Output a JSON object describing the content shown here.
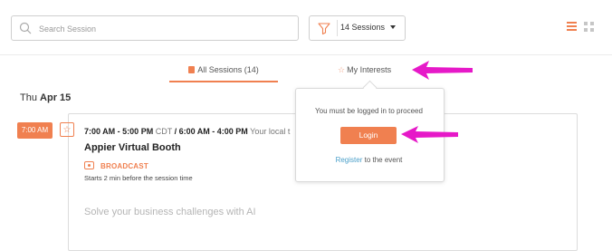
{
  "search": {
    "placeholder": "Search Session",
    "icon": "search-icon"
  },
  "filter": {
    "label": "14 Sessions",
    "icon": "funnel-icon"
  },
  "view_toggle": {
    "list_icon": "list-view-icon",
    "grid_icon": "grid-view-icon"
  },
  "tabs": [
    {
      "label": "All Sessions (14)",
      "icon": "book-icon",
      "active": true
    },
    {
      "label": "My Interests",
      "icon": "star-icon",
      "active": false
    }
  ],
  "date": {
    "day": "Thu",
    "date": "Apr 15"
  },
  "session": {
    "badge_time": "7:00 AM",
    "time_local": "7:00 AM - 5:00 PM",
    "tz_local": "CDT",
    "separator": "/",
    "time_user": "6:00 AM - 4:00 PM",
    "tz_user": "Your local t",
    "title": "Appier Virtual Booth",
    "broadcast_label": "BROADCAST",
    "starts_text": "Starts 2 min before the session time",
    "description": "Solve your business challenges with AI"
  },
  "popover": {
    "message": "You must be logged in to proceed",
    "login_label": "Login",
    "register_link": "Register",
    "register_rest": " to the event"
  },
  "colors": {
    "accent": "#f08050",
    "annotation": "#e619c8",
    "link": "#4a9fc9"
  }
}
